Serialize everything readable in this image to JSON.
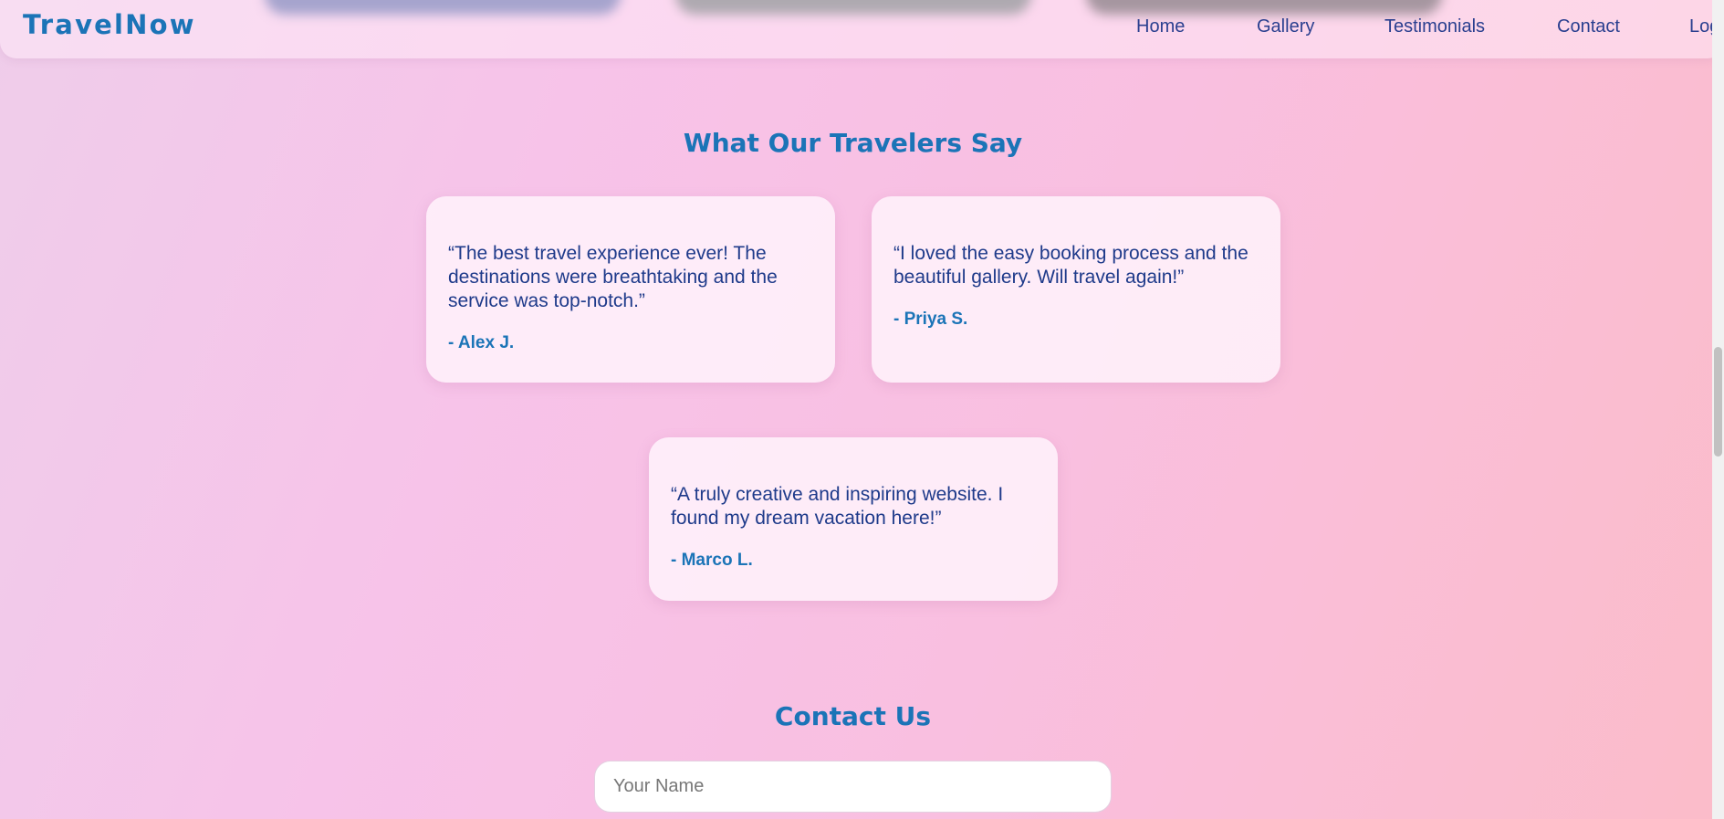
{
  "navbar": {
    "brand": "TravelNow",
    "links": [
      "Home",
      "Gallery",
      "Testimonials",
      "Contact",
      "Log"
    ]
  },
  "testimonials": {
    "title": "What Our Travelers Say",
    "items": [
      {
        "quote": "“The best travel experience ever! The destinations were breathtaking and the service was top-notch.”",
        "author": "- Alex J."
      },
      {
        "quote": "“I loved the easy booking process and the beautiful gallery. Will travel again!”",
        "author": "- Priya S."
      },
      {
        "quote": "“A truly creative and inspiring website. I found my dream vacation here!”",
        "author": "- Marco L."
      }
    ]
  },
  "contact": {
    "title": "Contact Us",
    "name_placeholder": "Your Name"
  },
  "colors": {
    "accent": "#1b74b7",
    "text": "#1e3a8a",
    "nav_text": "#2a3f8f"
  }
}
